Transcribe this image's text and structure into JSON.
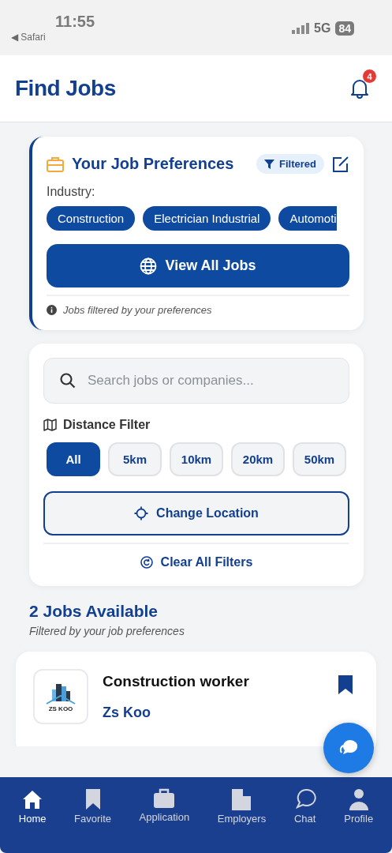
{
  "status_bar": {
    "time": "11:55",
    "back_app": "◀ Safari",
    "network": "5G",
    "battery": "84"
  },
  "header": {
    "title": "Find Jobs",
    "notifications": "4"
  },
  "preferences": {
    "title": "Your Job Preferences",
    "badge": "Filtered",
    "industry_label": "Industry:",
    "industries": [
      "Construction",
      "Electrician Industrial",
      "Automoti"
    ],
    "view_all": "View All Jobs",
    "note": "Jobs filtered by your preferences"
  },
  "search": {
    "placeholder": "Search jobs or companies..."
  },
  "distance": {
    "label": "Distance Filter",
    "options": [
      {
        "label": "All",
        "selected": true
      },
      {
        "label": "5km",
        "selected": false
      },
      {
        "label": "10km",
        "selected": false
      },
      {
        "label": "20km",
        "selected": false
      },
      {
        "label": "50km",
        "selected": false
      }
    ],
    "change_location": "Change Location",
    "clear": "Clear All Filters"
  },
  "results": {
    "title": "2 Jobs Available",
    "subtitle": "Filtered by your job preferences"
  },
  "jobs": [
    {
      "logo_text": "ZS KOO",
      "title": "Construction worker",
      "company": "Zs Koo",
      "saved": true
    }
  ],
  "nav": [
    {
      "label": "Home",
      "selected": true
    },
    {
      "label": "Favorite",
      "selected": false
    },
    {
      "label": "Application",
      "selected": false
    },
    {
      "label": "Employers",
      "selected": false
    },
    {
      "label": "Chat",
      "selected": false
    },
    {
      "label": "Profile",
      "selected": false
    }
  ]
}
